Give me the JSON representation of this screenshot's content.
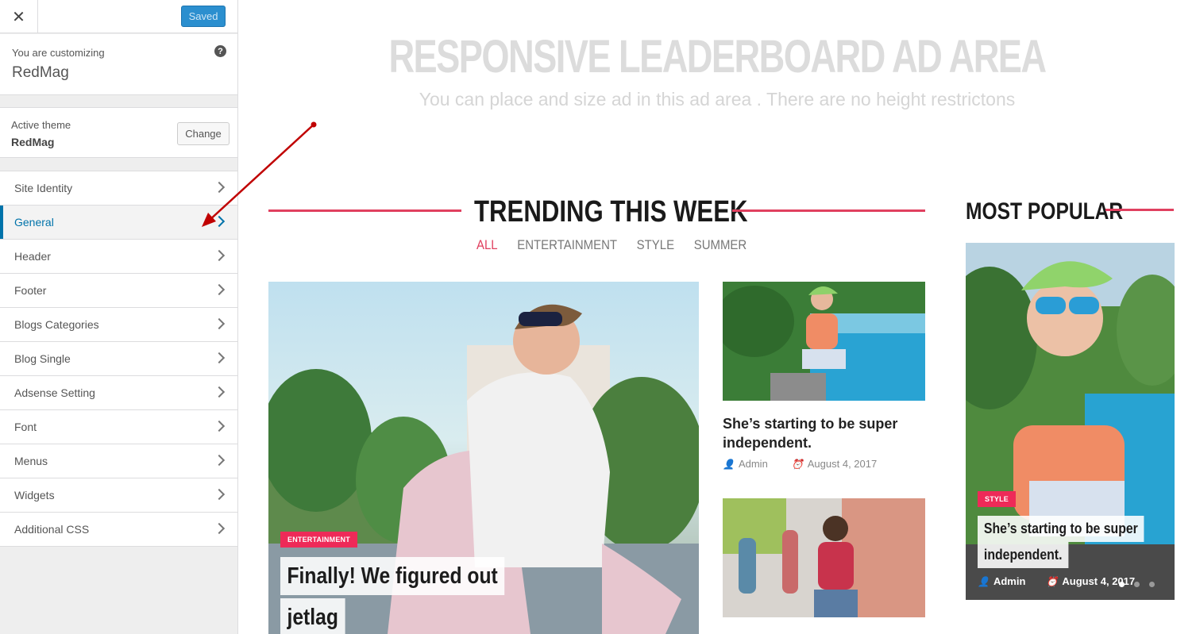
{
  "customizer": {
    "close_icon": "✕",
    "saved_label": "Saved",
    "customizing_label": "You are customizing",
    "site_name": "RedMag",
    "help_icon": "?",
    "active_theme_label": "Active theme",
    "active_theme_name": "RedMag",
    "change_label": "Change",
    "menu": [
      {
        "label": "Site Identity"
      },
      {
        "label": "General",
        "active": true
      },
      {
        "label": "Header"
      },
      {
        "label": "Footer"
      },
      {
        "label": "Blogs Categories"
      },
      {
        "label": "Blog Single"
      },
      {
        "label": "Adsense Setting"
      },
      {
        "label": "Font"
      },
      {
        "label": "Menus"
      },
      {
        "label": "Widgets"
      },
      {
        "label": "Additional CSS"
      }
    ]
  },
  "preview": {
    "ad_title": "RESPONSIVE LEADERBOARD AD  AREA",
    "ad_subtitle": "You can place and size ad in this ad area . There are no height restrictons",
    "trending_title": "TRENDING THIS WEEK",
    "filters": [
      "ALL",
      "ENTERTAINMENT",
      "STYLE",
      "SUMMER"
    ],
    "active_filter": "ALL",
    "featured": {
      "tag": "ENTERTAINMENT",
      "title_line1": "Finally! We figured out",
      "title_line2": "jetlag"
    },
    "side_post": {
      "title": "She’s starting to be super independent.",
      "author": "Admin",
      "date": "August 4, 2017"
    },
    "popular_title": "MOST POPULAR",
    "popular_post": {
      "tag": "STYLE",
      "title_line1": "She’s starting to be super",
      "title_line2": "independent.",
      "author": "Admin",
      "date": "August 4, 2017"
    }
  },
  "colors": {
    "accent": "#e0405f",
    "tag": "#ee2a58",
    "wp_blue": "#0073aa",
    "saved_button": "#2b8fcf",
    "annotation_arrow": "#c00000"
  }
}
